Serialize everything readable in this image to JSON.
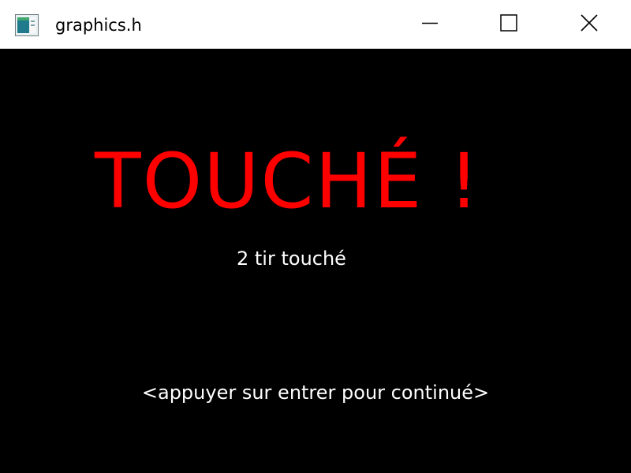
{
  "window": {
    "title": "graphics.h",
    "icon": "graphics-app-icon",
    "controls": {
      "minimize_icon": "minimize-icon",
      "maximize_icon": "maximize-icon",
      "close_icon": "close-icon"
    }
  },
  "game": {
    "headline": "TOUCHÉ !",
    "status": "2 tir touché",
    "prompt": "<appuyer sur entrer pour continué>"
  },
  "colors": {
    "background": "#000000",
    "headline": "#ff0000",
    "text": "#ffffff",
    "titlebar": "#ffffff"
  }
}
